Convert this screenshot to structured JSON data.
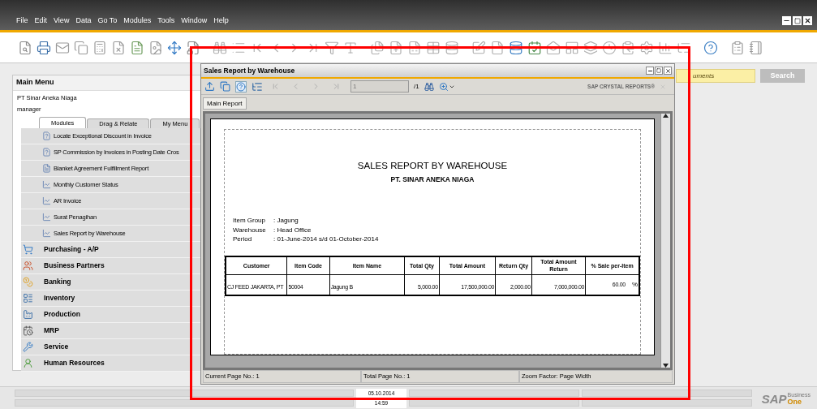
{
  "menu_bar": [
    "File",
    "Edit",
    "View",
    "Data",
    "Go To",
    "Modules",
    "Tools",
    "Window",
    "Help"
  ],
  "search": {
    "placeholder": "uments",
    "button": "Search"
  },
  "main_menu": {
    "title": "Main Menu",
    "company": "PT Sinar Aneka Niaga",
    "user": "manager",
    "tabs": [
      {
        "label": "Modules",
        "selected": true
      },
      {
        "label": "Drag & Relate",
        "selected": false
      },
      {
        "label": "My Menu",
        "selected": false
      }
    ],
    "report_items": [
      {
        "kind": "query",
        "label": "Locate Exceptional Discount in Invoice"
      },
      {
        "kind": "query",
        "label": "SP Commission by Invoices in Posting Date Cros"
      },
      {
        "kind": "document",
        "label": "Blanket Agreement Fulfillment Report"
      },
      {
        "kind": "crystal",
        "label": "Monthly Customer Status"
      },
      {
        "kind": "crystal",
        "label": "AR Invoice"
      },
      {
        "kind": "crystal",
        "label": "Surat Penagihan"
      },
      {
        "kind": "crystal",
        "label": "Sales Report by Warehouse"
      }
    ],
    "modules": [
      "Purchasing - A/P",
      "Business Partners",
      "Banking",
      "Inventory",
      "Production",
      "MRP",
      "Service",
      "Human Resources"
    ]
  },
  "report_window": {
    "title": "Sales Report by Warehouse",
    "page_field": "1",
    "page_total": "/1",
    "brand": "SAP CRYSTAL REPORTS®",
    "tabs": [
      {
        "label": "Main Report",
        "selected": true
      }
    ],
    "report": {
      "title": "SALES REPORT BY WAREHOUSE",
      "company": "PT. SINAR ANEKA NIAGA",
      "params": [
        {
          "label": "Item Group",
          "value": ": Jagung"
        },
        {
          "label": "Warehouse",
          "value": ": Head Office"
        },
        {
          "label": "Period",
          "value": ": 01-June-2014 s/d 01-October-2014"
        }
      ],
      "columns": [
        "Customer",
        "Item Code",
        "Item Name",
        "Total Qty",
        "Total Amount",
        "Return Qty",
        "Total Amount Return",
        "% Sale per-Item"
      ],
      "rows": [
        {
          "cells": [
            "CJ FEED JAKARTA, PT",
            "50004",
            "Jagung B",
            "5,000.00",
            "17,500,000.00",
            "2,000.00",
            "7,000,000.00",
            "60.00"
          ],
          "unit": "%"
        }
      ]
    },
    "status": [
      "Current Page No.: 1",
      "Total Page No.: 1",
      "Zoom Factor: Page Width"
    ]
  },
  "status_bar": {
    "date": "05.10.2014",
    "time": "14:59"
  },
  "logo": {
    "main": "SAP",
    "line1": "Business",
    "line2": "One"
  },
  "annotation_frame": {
    "shown": true
  }
}
